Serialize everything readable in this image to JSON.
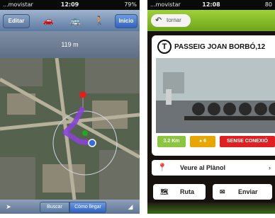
{
  "left_phone": {
    "status": {
      "carrier": "...movistar",
      "time": "12:09",
      "battery": "79%"
    },
    "nav": {
      "edit_label": "Editar",
      "start_label": "Inicio",
      "modes": [
        "car-icon",
        "bus-icon",
        "walk-icon"
      ]
    },
    "route": {
      "distance": "119 m"
    },
    "toolbar": {
      "search_label": "Buscar",
      "directions_label": "Cómo llegar"
    }
  },
  "right_phone": {
    "status": {
      "carrier": "...movistar",
      "time": "12:08",
      "battery": "80"
    },
    "back_label": "tornar",
    "station": {
      "name": "PASSEIG JOAN BORBÓ,12",
      "logo_letter": "T",
      "distance": "3.2 Km",
      "bikes": "6",
      "connection_status": "SENSE CONEXIÓ"
    },
    "map_button_label": "Veure al Plànol",
    "route_button_label": "Ruta",
    "send_button_label": "Enviar"
  },
  "colors": {
    "ios_blue": "#5b7aa2",
    "accent_green": "#8cc63f",
    "alert_red": "#e02020",
    "badge_orange": "#e8a600"
  }
}
